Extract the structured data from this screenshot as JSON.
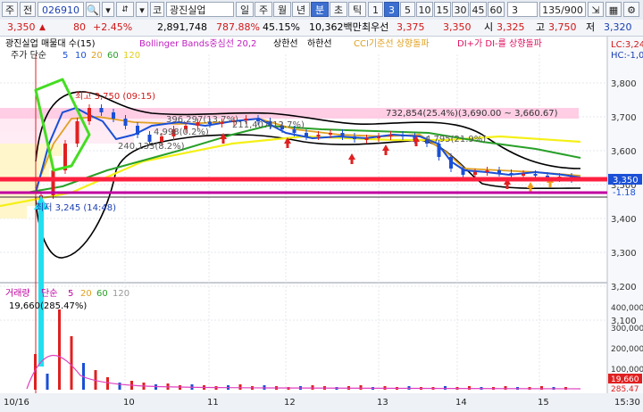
{
  "toolbar": {
    "market": "주",
    "prefix": "전",
    "code": "026910",
    "name_prefix": "코",
    "stock_name": "광진실업",
    "period_buttons": [
      "일",
      "주",
      "월",
      "년",
      "분",
      "초",
      "틱"
    ],
    "minute_buttons": [
      "1",
      "3",
      "5",
      "10",
      "15",
      "30",
      "45",
      "60"
    ],
    "count_select": "3",
    "page_counter": "135/900"
  },
  "info": {
    "price": "3,350",
    "change": "80",
    "change_pct": "+2.45%",
    "volume": "2,891,748",
    "vol_ratio": "787.88%",
    "turnover": "45.15%",
    "amount": "10,362백만",
    "best_sell_label": "최우선",
    "best_sell": "3,375",
    "best_buy": "3,350",
    "open_label": "시",
    "open": "3,325",
    "high_label": "고",
    "high": "3,750",
    "low_label": "저",
    "low": "3,320"
  },
  "chart": {
    "legend_title": "광진실업 매물대 수(15)",
    "legend_bb": "Bollinger Bands중심선 20,2",
    "legend_upper": "상한선",
    "legend_lower": "하한선",
    "legend_cci": "CCI기준선 상향돌파",
    "legend_di": "DI+가 DI-를 상향돌파",
    "lc_label": "LC:3,24",
    "hc_label": "HC:-1,0",
    "price_ma_label": "주가 단순",
    "ma_periods": [
      "5",
      "10",
      "20",
      "60",
      "120"
    ],
    "high_note": "최고 3,750 (09:15)",
    "low_note": "최저 3,245 (14:48)",
    "profile_note": "732,854(25.4%)(3,690.00 ~ 3,660.67)",
    "vp_notes": [
      "396,297(13.7%)",
      "211,407(12.7%)",
      "4,998(0.2%)",
      "240,133(8.2%)",
      "4,795(21.9%)"
    ],
    "y_ticks": [
      "3,800",
      "3,700",
      "3,600",
      "3,500",
      "3,400",
      "3,300",
      "3,200",
      "3,100"
    ],
    "current_price_tag": "3,350",
    "current_pct_tag": "-1.18",
    "volume_label": "거래량",
    "volume_ma_label": "단순",
    "volume_ma_periods": [
      "5",
      "20",
      "60",
      "120"
    ],
    "volume_note": "19,660(285.47%)",
    "vol_y_ticks": [
      "400,000",
      "300,000",
      "200,000",
      "100,000"
    ],
    "vol_tag": "19,660",
    "vol_pct_tag": "285.47",
    "x_labels": [
      "10/16",
      "10",
      "11",
      "12",
      "13",
      "14",
      "15",
      "15:30"
    ],
    "colors": {
      "up": "#e02020",
      "down": "#1a4fd6",
      "ma5": "#1a4fd6",
      "ma10": "#e0a020",
      "ma20": "#28a028",
      "ma60": "#f0f020",
      "bb": "#000000",
      "magenta": "#e020a0",
      "cyan": "#20e0f0",
      "green_box": "#44dd22"
    }
  }
}
